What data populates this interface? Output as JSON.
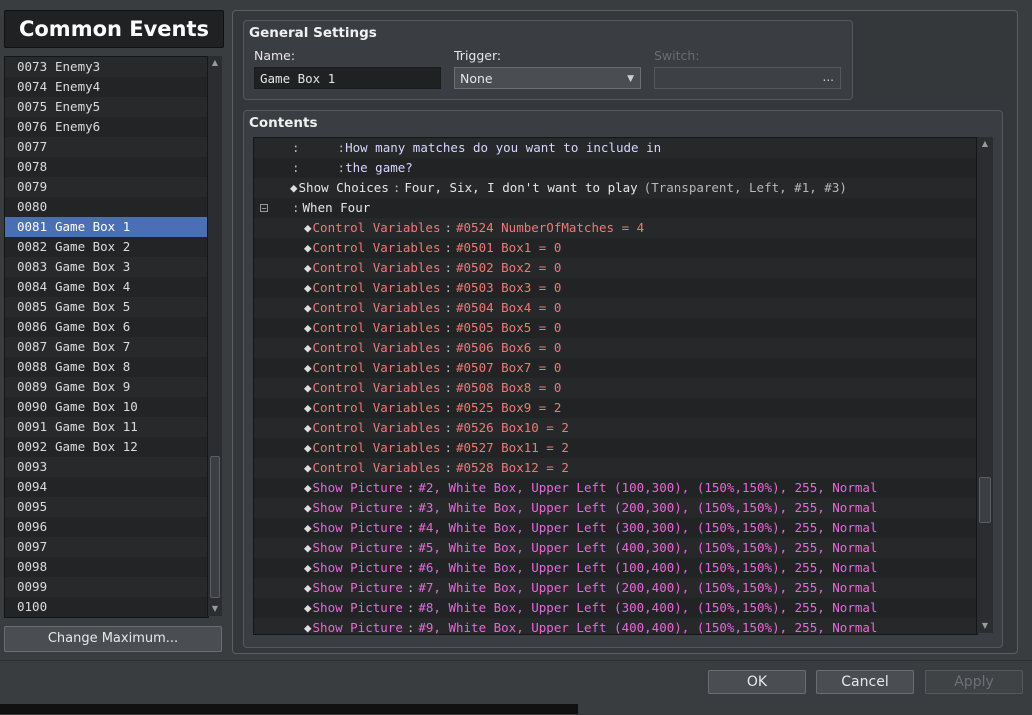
{
  "left_panel": {
    "title": "Common Events",
    "events": [
      {
        "id": "0073",
        "name": "Enemy3"
      },
      {
        "id": "0074",
        "name": "Enemy4"
      },
      {
        "id": "0075",
        "name": "Enemy5"
      },
      {
        "id": "0076",
        "name": "Enemy6"
      },
      {
        "id": "0077",
        "name": ""
      },
      {
        "id": "0078",
        "name": ""
      },
      {
        "id": "0079",
        "name": ""
      },
      {
        "id": "0080",
        "name": ""
      },
      {
        "id": "0081",
        "name": "Game Box 1",
        "selected": true
      },
      {
        "id": "0082",
        "name": "Game Box 2"
      },
      {
        "id": "0083",
        "name": "Game Box 3"
      },
      {
        "id": "0084",
        "name": "Game Box 4"
      },
      {
        "id": "0085",
        "name": "Game Box 5"
      },
      {
        "id": "0086",
        "name": "Game Box 6"
      },
      {
        "id": "0087",
        "name": "Game Box 7"
      },
      {
        "id": "0088",
        "name": "Game Box 8"
      },
      {
        "id": "0089",
        "name": "Game Box 9"
      },
      {
        "id": "0090",
        "name": "Game Box 10"
      },
      {
        "id": "0091",
        "name": "Game Box 11"
      },
      {
        "id": "0092",
        "name": "Game Box 12"
      },
      {
        "id": "0093",
        "name": ""
      },
      {
        "id": "0094",
        "name": ""
      },
      {
        "id": "0095",
        "name": ""
      },
      {
        "id": "0096",
        "name": ""
      },
      {
        "id": "0097",
        "name": ""
      },
      {
        "id": "0098",
        "name": ""
      },
      {
        "id": "0099",
        "name": ""
      },
      {
        "id": "0100",
        "name": ""
      }
    ],
    "change_maximum_label": "Change Maximum..."
  },
  "general": {
    "title": "General Settings",
    "name_label": "Name:",
    "name_value": "Game Box 1",
    "trigger_label": "Trigger:",
    "trigger_value": "None",
    "switch_label": "Switch:",
    "switch_button": "..."
  },
  "contents": {
    "title": "Contents",
    "commands": [
      {
        "type": "text",
        "indent": 0,
        "text": "How many matches do you want to include in"
      },
      {
        "type": "text",
        "indent": 0,
        "text": "the game?"
      },
      {
        "type": "choices",
        "name": "Show Choices",
        "params": "Four, Six, I don't want to play",
        "extra": "(Transparent, Left, #1, #3)"
      },
      {
        "type": "when",
        "text": "When Four"
      },
      {
        "type": "var",
        "name": "Control Variables",
        "params": "#0524 NumberOfMatches = 4"
      },
      {
        "type": "var",
        "name": "Control Variables",
        "params": "#0501 Box1 = 0"
      },
      {
        "type": "var",
        "name": "Control Variables",
        "params": "#0502 Box2 = 0"
      },
      {
        "type": "var",
        "name": "Control Variables",
        "params": "#0503 Box3 = 0"
      },
      {
        "type": "var",
        "name": "Control Variables",
        "params": "#0504 Box4 = 0"
      },
      {
        "type": "var",
        "name": "Control Variables",
        "params": "#0505 Box5 = 0"
      },
      {
        "type": "var",
        "name": "Control Variables",
        "params": "#0506 Box6 = 0"
      },
      {
        "type": "var",
        "name": "Control Variables",
        "params": "#0507 Box7 = 0"
      },
      {
        "type": "var",
        "name": "Control Variables",
        "params": "#0508 Box8 = 0"
      },
      {
        "type": "var",
        "name": "Control Variables",
        "params": "#0525 Box9 = 2"
      },
      {
        "type": "var",
        "name": "Control Variables",
        "params": "#0526 Box10 = 2"
      },
      {
        "type": "var",
        "name": "Control Variables",
        "params": "#0527 Box11 = 2"
      },
      {
        "type": "var",
        "name": "Control Variables",
        "params": "#0528 Box12 = 2"
      },
      {
        "type": "pic",
        "name": "Show Picture",
        "params": "#2, White Box, Upper Left (100,300), (150%,150%), 255, Normal"
      },
      {
        "type": "pic",
        "name": "Show Picture",
        "params": "#3, White Box, Upper Left (200,300), (150%,150%), 255, Normal"
      },
      {
        "type": "pic",
        "name": "Show Picture",
        "params": "#4, White Box, Upper Left (300,300), (150%,150%), 255, Normal"
      },
      {
        "type": "pic",
        "name": "Show Picture",
        "params": "#5, White Box, Upper Left (400,300), (150%,150%), 255, Normal"
      },
      {
        "type": "pic",
        "name": "Show Picture",
        "params": "#6, White Box, Upper Left (100,400), (150%,150%), 255, Normal"
      },
      {
        "type": "pic",
        "name": "Show Picture",
        "params": "#7, White Box, Upper Left (200,400), (150%,150%), 255, Normal"
      },
      {
        "type": "pic",
        "name": "Show Picture",
        "params": "#8, White Box, Upper Left (300,400), (150%,150%), 255, Normal"
      },
      {
        "type": "pic",
        "name": "Show Picture",
        "params": "#9, White Box, Upper Left (400,400), (150%,150%), 255, Normal"
      }
    ]
  },
  "buttons": {
    "ok": "OK",
    "cancel": "Cancel",
    "apply": "Apply"
  },
  "colors": {
    "selection": "#4a6fb5",
    "control_variables": "#f07878",
    "show_picture": "#e868d8",
    "message_text": "#d6d6ff"
  }
}
